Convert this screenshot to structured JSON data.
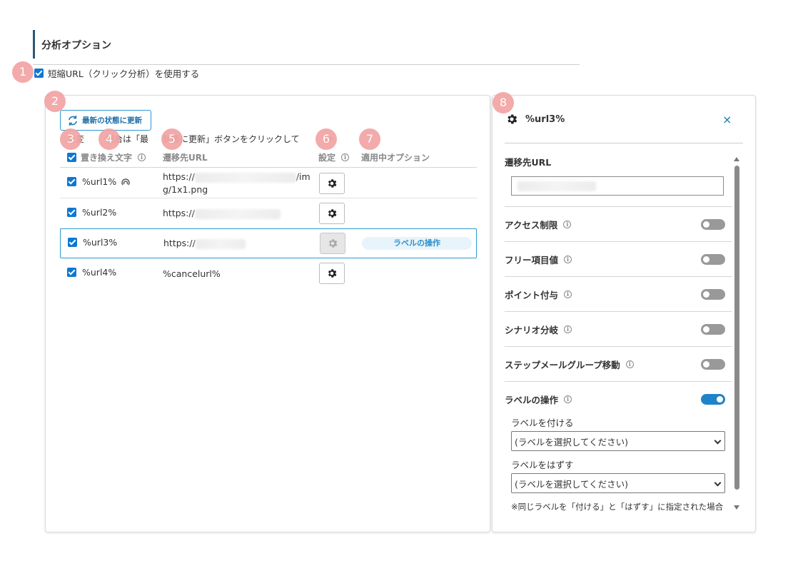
{
  "section": {
    "title": "分析オプション"
  },
  "short_url": {
    "label": "短縮URL（クリック分析）を使用する",
    "checked": true
  },
  "badges": [
    "1",
    "2",
    "3",
    "4",
    "5",
    "6",
    "7",
    "8"
  ],
  "left_panel": {
    "refresh_label": "最新の状態に更新",
    "note_part1": "を変",
    "note_part2": "場合は「最",
    "note_part3": "状態に更新」ボタンをクリックして",
    "note_part4": "い",
    "headers": {
      "replace_text": "置き換え文字",
      "dest_url": "遷移先URL",
      "settings": "設定",
      "applied_options": "適用中オプション"
    },
    "rows": [
      {
        "name": "%url1%",
        "url_prefix": "https://",
        "url_suffix": "/im",
        "url_line2": "g/1x1.png",
        "option": ""
      },
      {
        "name": "%url2%",
        "url_prefix": "https://",
        "option": ""
      },
      {
        "name": "%url3%",
        "url_prefix": "https://",
        "option": "ラベルの操作"
      },
      {
        "name": "%url4%",
        "url_prefix": "%cancelurl%",
        "option": ""
      }
    ]
  },
  "right_panel": {
    "title": "%url3%",
    "close": "×",
    "dest_url_label": "遷移先URL",
    "options": [
      {
        "label": "アクセス制限",
        "on": false
      },
      {
        "label": "フリー項目値",
        "on": false
      },
      {
        "label": "ポイント付与",
        "on": false
      },
      {
        "label": "シナリオ分岐",
        "on": false
      },
      {
        "label": "ステップメールグループ移動",
        "on": false
      },
      {
        "label": "ラベルの操作",
        "on": true
      }
    ],
    "add_label_title": "ラベルを付ける",
    "add_label_value": "(ラベルを選択してください)",
    "remove_label_title": "ラベルをはずす",
    "remove_label_value": "(ラベルを選択してください)",
    "footnote": "※同じラベルを「付ける」と「はずす」に指定された場合"
  },
  "colors": {
    "accent": "#1d84c9",
    "badge": "#f3a3a3",
    "checkbox": "#0d78d3"
  }
}
